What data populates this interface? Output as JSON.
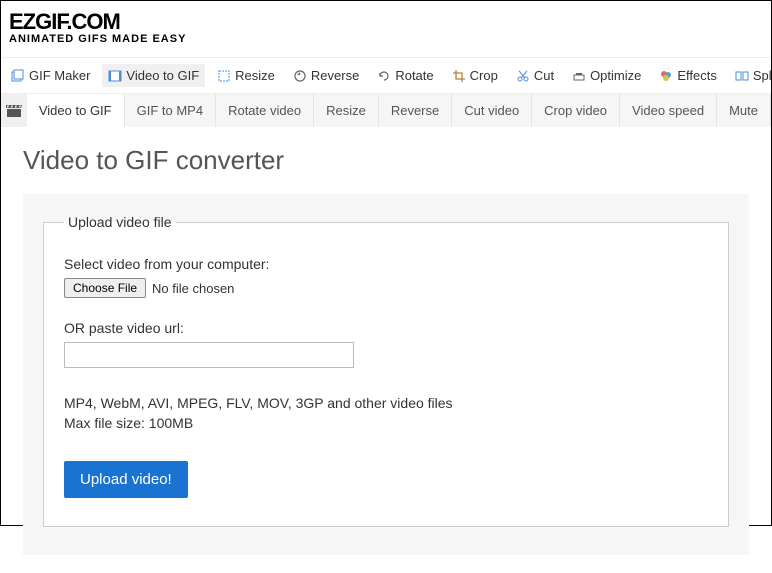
{
  "logo": {
    "main_text": "EZGIF.COM",
    "tagline": "ANIMATED GIFS MADE EASY"
  },
  "nav1": [
    {
      "label": "GIF Maker",
      "icon": "image-stack-icon"
    },
    {
      "label": "Video to GIF",
      "icon": "film-icon",
      "active": true
    },
    {
      "label": "Resize",
      "icon": "resize-icon"
    },
    {
      "label": "Reverse",
      "icon": "reverse-icon"
    },
    {
      "label": "Rotate",
      "icon": "rotate-icon"
    },
    {
      "label": "Crop",
      "icon": "crop-icon"
    },
    {
      "label": "Cut",
      "icon": "cut-icon"
    },
    {
      "label": "Optimize",
      "icon": "optimize-icon"
    },
    {
      "label": "Effects",
      "icon": "effects-icon"
    },
    {
      "label": "Split",
      "icon": "split-icon"
    }
  ],
  "nav2": [
    {
      "label": "Video to GIF",
      "active": true
    },
    {
      "label": "GIF to MP4"
    },
    {
      "label": "Rotate video"
    },
    {
      "label": "Resize"
    },
    {
      "label": "Reverse"
    },
    {
      "label": "Cut video"
    },
    {
      "label": "Crop video"
    },
    {
      "label": "Video speed"
    },
    {
      "label": "Mute"
    }
  ],
  "page_title": "Video to GIF converter",
  "upload": {
    "legend": "Upload video file",
    "select_label": "Select video from your computer:",
    "choose_file_btn": "Choose File",
    "no_file_text": "No file chosen",
    "or_paste_label": "OR paste video url:",
    "url_value": "",
    "formats_line": "MP4, WebM, AVI, MPEG, FLV, MOV, 3GP and other video files",
    "max_size_line": "Max file size: 100MB",
    "upload_btn_label": "Upload video!"
  }
}
